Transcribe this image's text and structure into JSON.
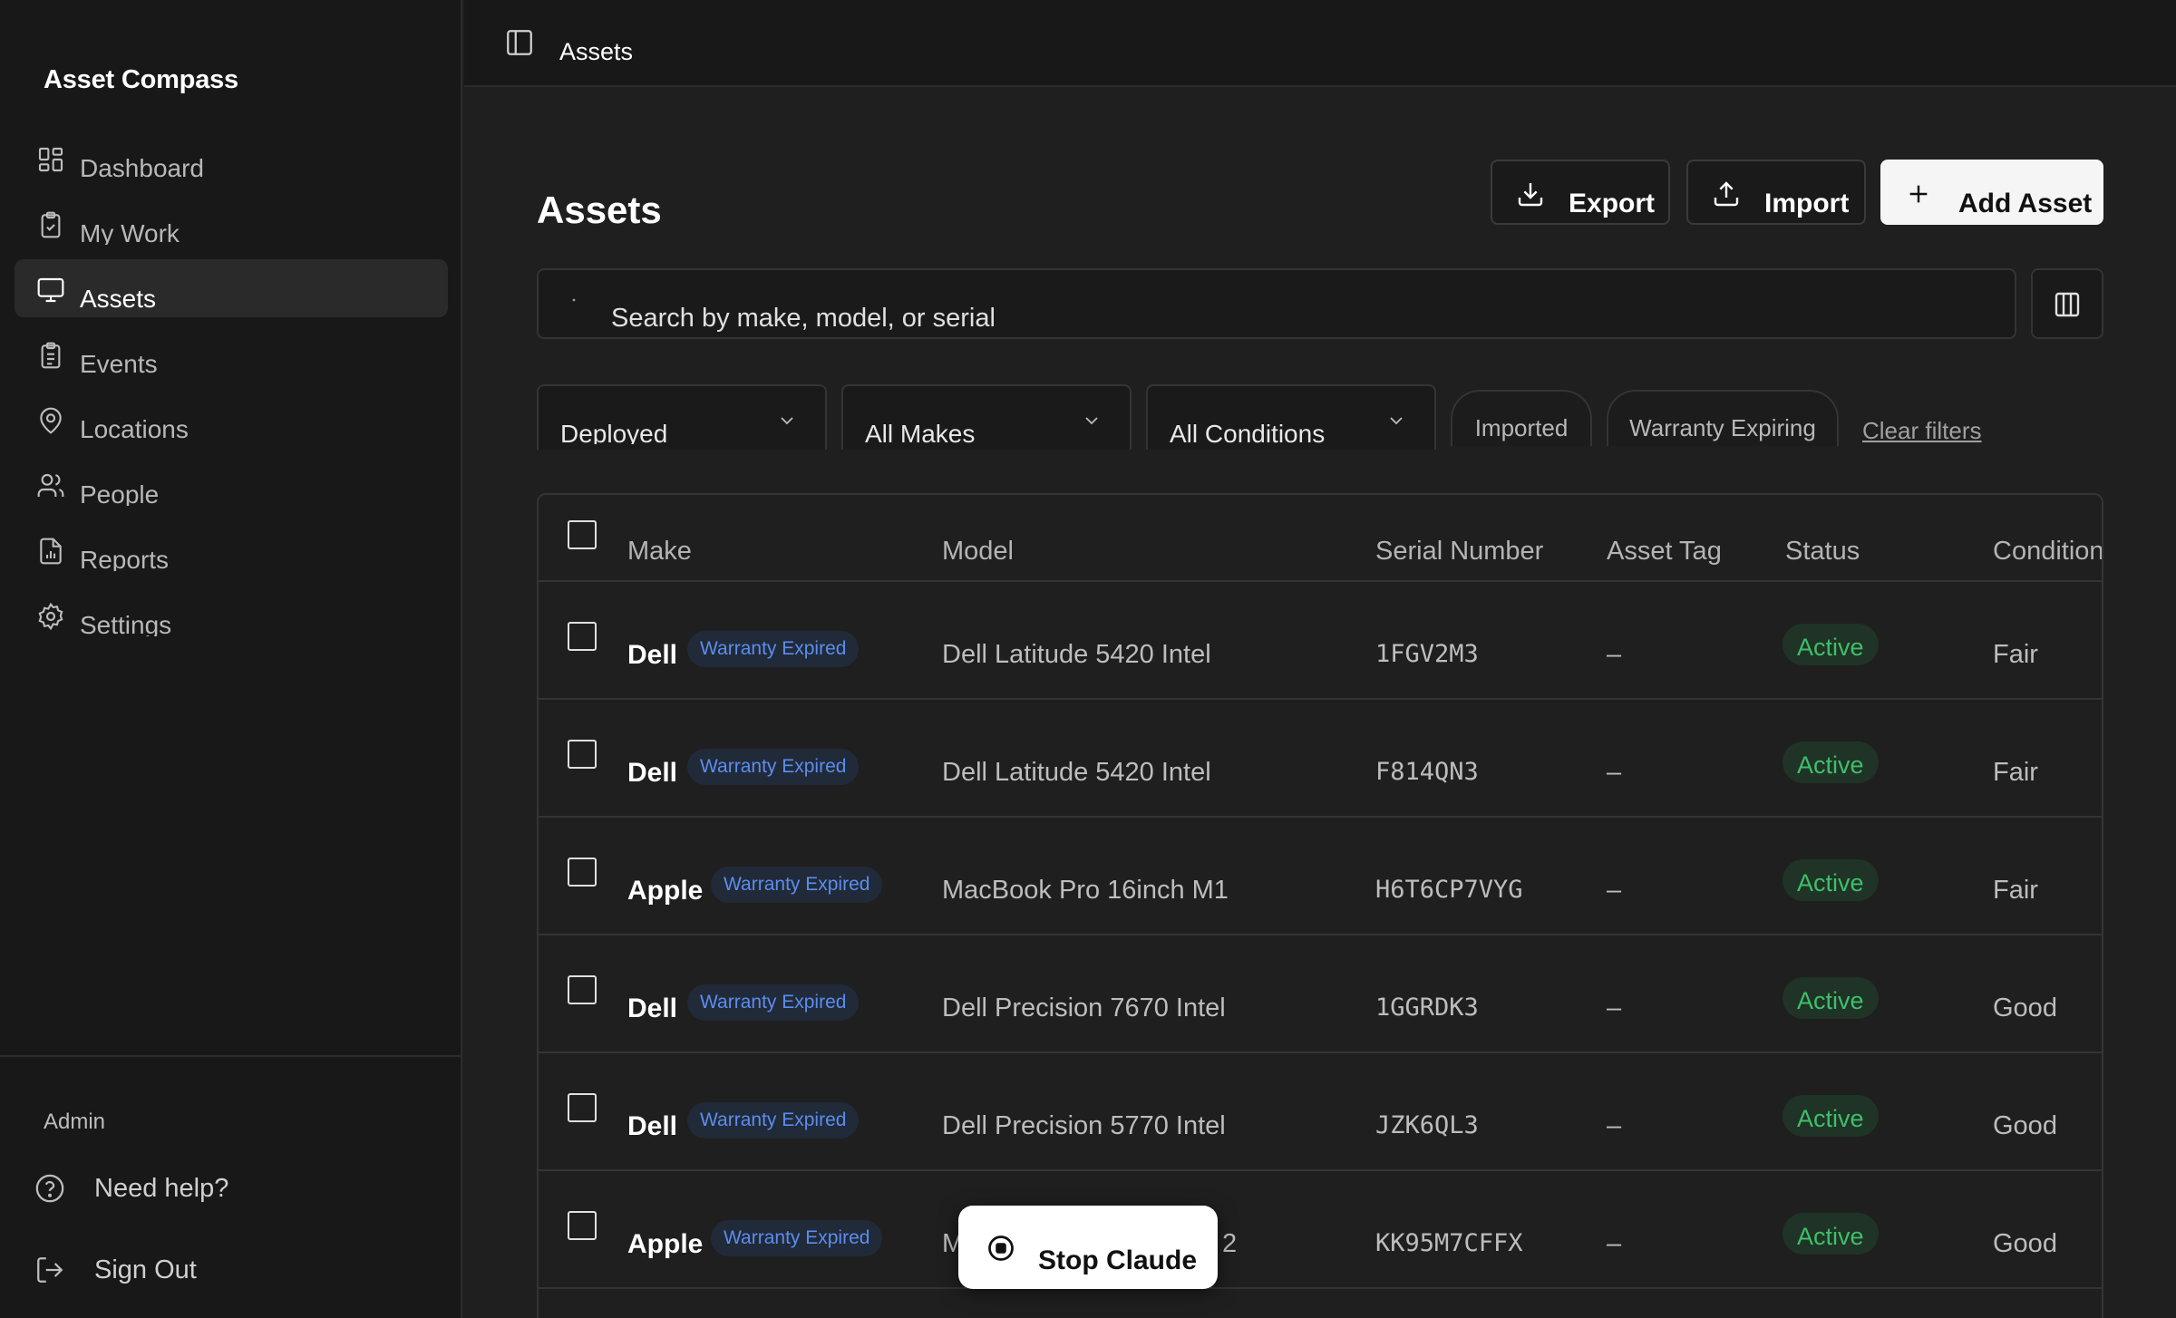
{
  "app": {
    "brand": "Asset Compass"
  },
  "sidebar": {
    "items": [
      {
        "label": "Dashboard",
        "icon": "grid-icon",
        "active": false
      },
      {
        "label": "My Work",
        "icon": "clipboard-icon",
        "active": false
      },
      {
        "label": "Assets",
        "icon": "monitor-icon",
        "active": true
      },
      {
        "label": "Events",
        "icon": "clipboard-list-icon",
        "active": false
      },
      {
        "label": "Locations",
        "icon": "map-pin-icon",
        "active": false
      },
      {
        "label": "People",
        "icon": "users-icon",
        "active": false
      },
      {
        "label": "Reports",
        "icon": "file-chart-icon",
        "active": false
      },
      {
        "label": "Settings",
        "icon": "gear-icon",
        "active": false
      }
    ],
    "footer": {
      "section_label": "Admin",
      "help_label": "Need help?",
      "signout_label": "Sign Out"
    }
  },
  "topbar": {
    "breadcrumb": "Assets"
  },
  "main": {
    "title": "Assets",
    "actions": {
      "export": "Export",
      "import": "Import",
      "add": "Add Asset"
    },
    "search": {
      "placeholder": "Search by make, model, or serial",
      "value": ""
    },
    "filters": {
      "status": "Deployed",
      "make": "All Makes",
      "condition": "All Conditions",
      "chips": [
        "Imported",
        "Warranty Expiring"
      ],
      "clear": "Clear filters"
    },
    "table": {
      "columns": [
        "Make",
        "Model",
        "Serial Number",
        "Asset Tag",
        "Status",
        "Condition"
      ],
      "rows": [
        {
          "make": "Dell",
          "badge": "Warranty Expired",
          "model": "Dell Latitude 5420 Intel",
          "serial": "1FGV2M3",
          "tag": "–",
          "status": "Active",
          "condition": "Fair"
        },
        {
          "make": "Dell",
          "badge": "Warranty Expired",
          "model": "Dell Latitude 5420 Intel",
          "serial": "F814QN3",
          "tag": "–",
          "status": "Active",
          "condition": "Fair"
        },
        {
          "make": "Apple",
          "badge": "Warranty Expired",
          "model": "MacBook Pro 16inch M1",
          "serial": "H6T6CP7VYG",
          "tag": "–",
          "status": "Active",
          "condition": "Fair"
        },
        {
          "make": "Dell",
          "badge": "Warranty Expired",
          "model": "Dell Precision 7670 Intel",
          "serial": "1GGRDK3",
          "tag": "–",
          "status": "Active",
          "condition": "Good"
        },
        {
          "make": "Dell",
          "badge": "Warranty Expired",
          "model": "Dell Precision 5770 Intel",
          "serial": "JZK6QL3",
          "tag": "–",
          "status": "Active",
          "condition": "Good"
        },
        {
          "make": "Apple",
          "badge": "Warranty Expired",
          "model": "M",
          "model_tail": "2",
          "serial": "KK95M7CFFX",
          "tag": "–",
          "status": "Active",
          "condition": "Good"
        }
      ]
    }
  },
  "overlay": {
    "stop_label": "Stop Claude"
  },
  "colors": {
    "background": "#1f1f1f",
    "sidebar": "#181818",
    "badge_text": "#5b8def",
    "status_active": "#3fbf6a",
    "primary_button": "#f5f5f5"
  }
}
